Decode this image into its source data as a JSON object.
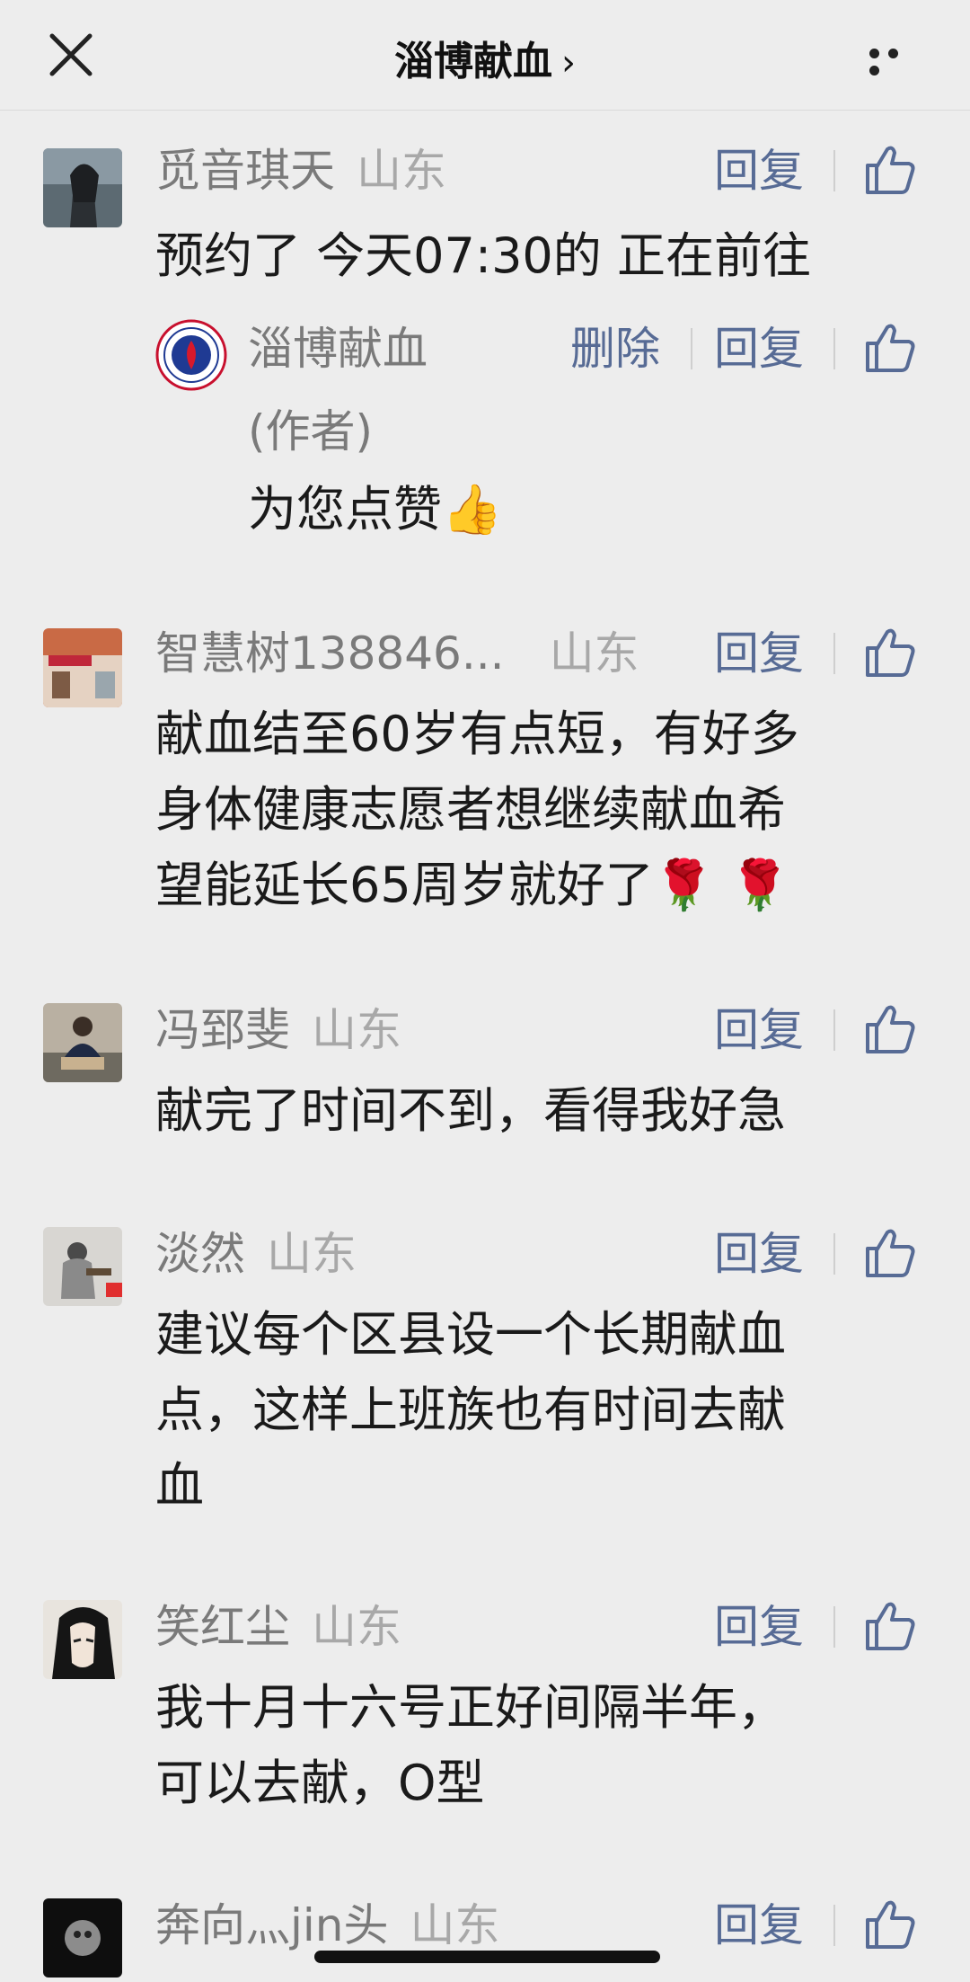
{
  "header": {
    "title": "淄博献血",
    "chevron": "›"
  },
  "comments": [
    {
      "name": "觅音琪天",
      "region": "山东",
      "reply_label": "回复",
      "text": "预约了 今天07:30的 正在前往",
      "author_reply": {
        "name": "淄博献血",
        "tag": "(作者)",
        "delete_label": "删除",
        "reply_label": "回复",
        "text": "为您点赞👍"
      }
    },
    {
      "name": "智慧树138846...",
      "region": "山东",
      "reply_label": "回复",
      "text_lines": [
        "献血结至60岁有点短，有好多",
        "身体健康志愿者想继续献血希",
        "望能延长65周岁就好了🌹 🌹"
      ]
    },
    {
      "name": "冯郅斐",
      "region": "山东",
      "reply_label": "回复",
      "text": "献完了时间不到，看得我好急"
    },
    {
      "name": "淡然",
      "region": "山东",
      "reply_label": "回复",
      "text_lines": [
        "建议每个区县设一个长期献血",
        "点，这样上班族也有时间去献",
        "血"
      ]
    },
    {
      "name": "笑红尘",
      "region": "山东",
      "reply_label": "回复",
      "text_lines": [
        "我十月十六号正好间隔半年，",
        "可以去献，O型"
      ]
    },
    {
      "name": "奔向灬jin头",
      "region": "山东",
      "reply_label": "回复"
    }
  ],
  "colors": {
    "background": "#ededed",
    "link": "#576b95",
    "name": "#7a7a7a",
    "region": "#a8a8a8"
  }
}
